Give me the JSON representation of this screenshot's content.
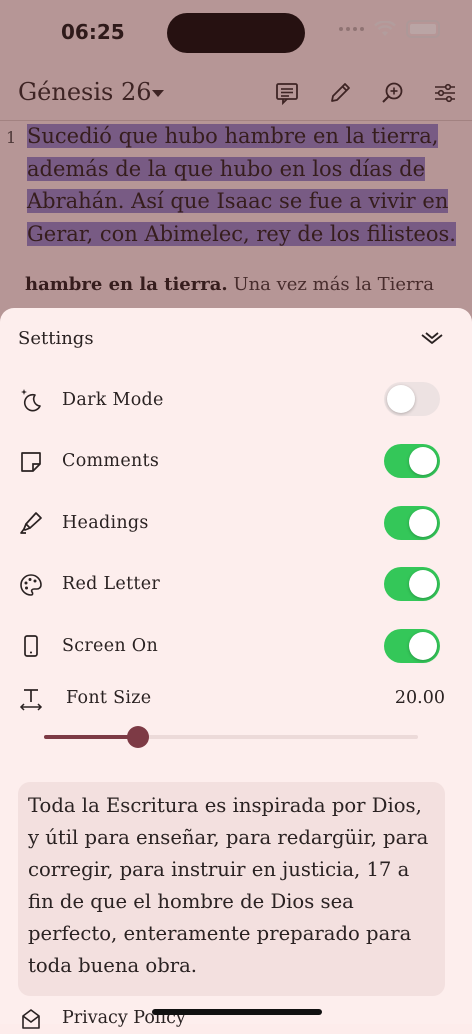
{
  "status": {
    "time": "06:25"
  },
  "header": {
    "chapter": "Génesis 26",
    "icons": [
      "comment-icon",
      "pencil-icon",
      "zoom-in-icon",
      "sliders-icon"
    ]
  },
  "passage": {
    "verse_number": "1",
    "verse_text": "Sucedió que hubo hambre en la tierra, además de la que hubo en los días de Abrahán. Así que Isaac se fue a vivir en Gerar, con Abimelec, rey de los filisteos.",
    "comment_bold": "hambre en la tierra.",
    "comment_rest": " Una vez más la Tierra"
  },
  "settings": {
    "title": "Settings",
    "rows": [
      {
        "label": "Dark Mode",
        "icon": "moon-stars-icon",
        "on": false
      },
      {
        "label": "Comments",
        "icon": "note-icon",
        "on": true
      },
      {
        "label": "Headings",
        "icon": "highlighter-icon",
        "on": true
      },
      {
        "label": "Red Letter",
        "icon": "palette-icon",
        "on": true
      },
      {
        "label": "Screen On",
        "icon": "phone-icon",
        "on": true
      }
    ],
    "font_size": {
      "label": "Font Size",
      "value": "20.00",
      "slider_fraction": 0.25
    },
    "quote": "Toda la Escritura es inspirada por Dios, y útil para enseñar, para redargüir, para corregir, para instruir en justicia, 17 a fin de que el hombre de Dios sea perfecto, enteramente preparado para toda buena obra.",
    "privacy_label": "Privacy Policy"
  },
  "colors": {
    "accent": "#7d3a45",
    "toggle_on": "#34c759",
    "highlight": "#8d80c6",
    "sheet_bg": "#fdeeed"
  }
}
